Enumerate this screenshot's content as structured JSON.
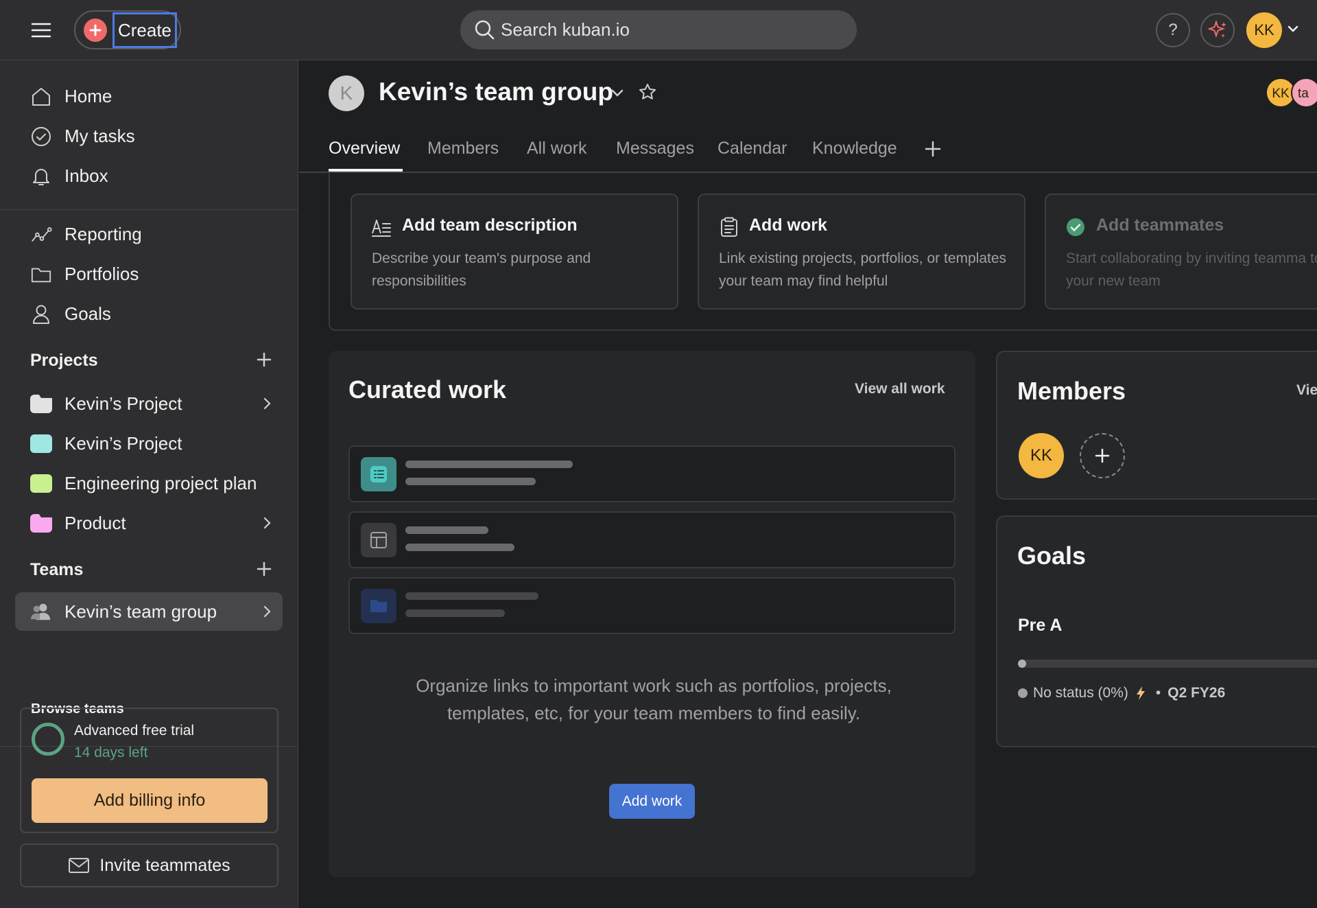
{
  "topbar": {
    "create_label": "Create",
    "search_placeholder": "Search kuban.io",
    "help_label": "?",
    "user_initials": "KK"
  },
  "sidebar": {
    "main_items": [
      {
        "label": "Home",
        "icon": "home-icon"
      },
      {
        "label": "My tasks",
        "icon": "check-circle-icon"
      },
      {
        "label": "Inbox",
        "icon": "bell-icon"
      }
    ],
    "insight_items": [
      {
        "label": "Reporting",
        "icon": "chart-line-icon"
      },
      {
        "label": "Portfolios",
        "icon": "folder-icon"
      },
      {
        "label": "Goals",
        "icon": "person-icon"
      }
    ],
    "projects_header": "Projects",
    "projects": [
      {
        "label": "Kevin’s Project",
        "color": "#e2e2e2",
        "kind": "folder",
        "has_arrow": true
      },
      {
        "label": "Kevin’s Project",
        "color": "#9ee7e3",
        "kind": "square",
        "has_arrow": false
      },
      {
        "label": "Engineering project plan",
        "color": "#c7f08e",
        "kind": "square",
        "has_arrow": false
      },
      {
        "label": "Product",
        "color": "#f9aaef",
        "kind": "folder",
        "has_arrow": true
      }
    ],
    "teams_header": "Teams",
    "teams": [
      {
        "label": "Kevin’s team group",
        "icon": "team-icon",
        "active": true
      }
    ],
    "browse_teams": "Browse teams",
    "trial": {
      "title": "Advanced free trial",
      "days_left": "14 days left",
      "billing_button": "Add billing info"
    },
    "invite_button": "Invite teammates"
  },
  "team_header": {
    "avatar_letter": "K",
    "title": "Kevin’s team group",
    "member_faces": [
      "KK",
      "ta"
    ]
  },
  "tabs": [
    {
      "label": "Overview",
      "active": true
    },
    {
      "label": "Members",
      "active": false
    },
    {
      "label": "All work",
      "active": false
    },
    {
      "label": "Messages",
      "active": false
    },
    {
      "label": "Calendar",
      "active": false
    },
    {
      "label": "Knowledge",
      "active": false
    }
  ],
  "setup_cards": [
    {
      "title": "Add team description",
      "description": "Describe your team's purpose and responsibilities",
      "icon": "text-description-icon"
    },
    {
      "title": "Add work",
      "description": "Link existing projects, portfolios, or templates your team may find helpful",
      "icon": "clipboard-icon"
    },
    {
      "title": "Add teammates",
      "description": "Start collaborating by inviting teamma to your new team",
      "icon": "check-badge-icon"
    }
  ],
  "curated_work": {
    "title": "Curated work",
    "view_all": "View all work",
    "description": "Organize links to important work such as portfolios, projects, templates, etc, for your team members to find easily.",
    "add_button": "Add work",
    "colors": {
      "list_thumb": "#4ecbc4",
      "folder_thumb": "#2c4a8a"
    }
  },
  "members_panel": {
    "title": "Members",
    "view_label": "Vie",
    "member_initials": "KK"
  },
  "goals_panel": {
    "title": "Goals",
    "goal_name": "Pre A",
    "progress": 0,
    "status": "No status (0%)",
    "separator": "•",
    "period": "Q2 FY26"
  },
  "colors": {
    "accent_blue": "#4573d2",
    "create_red": "#f06a6a",
    "avatar_yellow": "#f4b740",
    "billing_orange": "#f1bd83",
    "trial_green": "#5da283"
  }
}
